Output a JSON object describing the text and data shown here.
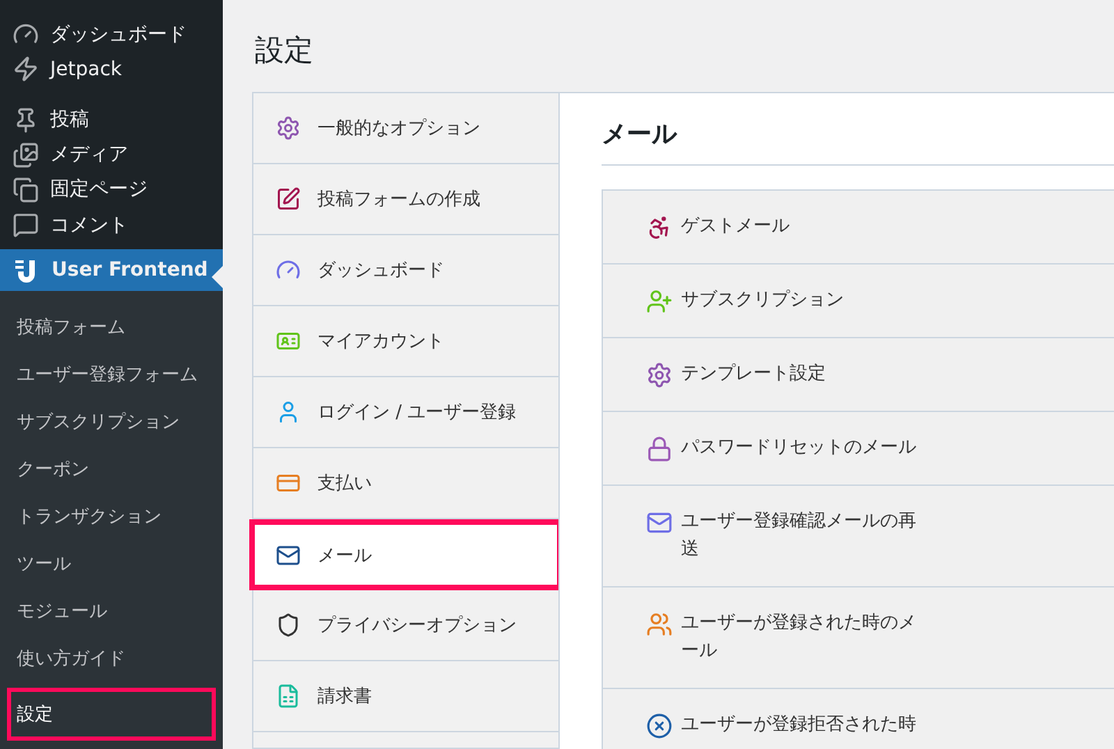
{
  "sidebar": {
    "items": [
      {
        "label": "ダッシュボード",
        "selected": false
      },
      {
        "label": "Jetpack",
        "selected": false
      },
      {
        "label": "投稿",
        "selected": false
      },
      {
        "label": "メディア",
        "selected": false
      },
      {
        "label": "固定ページ",
        "selected": false
      },
      {
        "label": "コメント",
        "selected": false
      },
      {
        "label": "User Frontend",
        "selected": true
      }
    ],
    "submenu": [
      {
        "label": "投稿フォーム",
        "selected": false,
        "highlighted": false
      },
      {
        "label": "ユーザー登録フォーム",
        "selected": false,
        "highlighted": false
      },
      {
        "label": "サブスクリプション",
        "selected": false,
        "highlighted": false
      },
      {
        "label": "クーポン",
        "selected": false,
        "highlighted": false
      },
      {
        "label": "トランザクション",
        "selected": false,
        "highlighted": false
      },
      {
        "label": "ツール",
        "selected": false,
        "highlighted": false
      },
      {
        "label": "モジュール",
        "selected": false,
        "highlighted": false
      },
      {
        "label": "使い方ガイド",
        "selected": false,
        "highlighted": false
      },
      {
        "label": "設定",
        "selected": true,
        "highlighted": true
      }
    ]
  },
  "page_title": "設定",
  "settings_tabs": [
    {
      "label": "一般的なオプション",
      "selected": false,
      "highlighted": false
    },
    {
      "label": "投稿フォームの作成",
      "selected": false,
      "highlighted": false
    },
    {
      "label": "ダッシュボード",
      "selected": false,
      "highlighted": false
    },
    {
      "label": "マイアカウント",
      "selected": false,
      "highlighted": false
    },
    {
      "label": "ログイン / ユーザー登録",
      "selected": false,
      "highlighted": false
    },
    {
      "label": "支払い",
      "selected": false,
      "highlighted": false
    },
    {
      "label": "メール",
      "selected": true,
      "highlighted": true
    },
    {
      "label": "プライバシーオプション",
      "selected": false,
      "highlighted": false
    },
    {
      "label": "請求書",
      "selected": false,
      "highlighted": false
    }
  ],
  "panel": {
    "title": "メール",
    "sections": [
      {
        "label": "ゲストメール"
      },
      {
        "label": "サブスクリプション"
      },
      {
        "label": "テンプレート設定"
      },
      {
        "label": "パスワードリセットのメール"
      },
      {
        "label": "ユーザー登録確認メールの再送"
      },
      {
        "label": "ユーザーが登録された時のメール"
      },
      {
        "label": "ユーザーが登録拒否された時"
      }
    ]
  }
}
